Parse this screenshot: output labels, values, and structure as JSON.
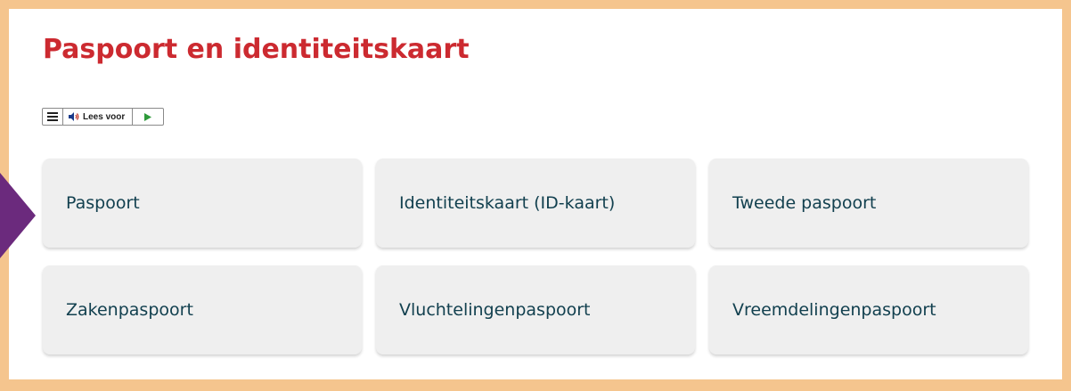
{
  "page": {
    "title": "Paspoort en identiteitskaart"
  },
  "readspeaker": {
    "menu_icon": "hamburger-menu-icon",
    "speaker_icon": "speaker-icon",
    "listen_label": "Lees voor",
    "play_icon": "play-icon"
  },
  "cards": [
    {
      "label": "Paspoort"
    },
    {
      "label": "Identiteitskaart (ID-kaart)"
    },
    {
      "label": "Tweede paspoort"
    },
    {
      "label": "Zakenpaspoort"
    },
    {
      "label": "Vluchtelingenpaspoort"
    },
    {
      "label": "Vreemdelingenpaspoort"
    }
  ],
  "colors": {
    "frame": "#f5c58e",
    "title": "#cc2a30",
    "card_background": "#efefef",
    "card_text": "#12404f",
    "arrow": "#6b2a7d",
    "play": "#2e9a3a"
  }
}
